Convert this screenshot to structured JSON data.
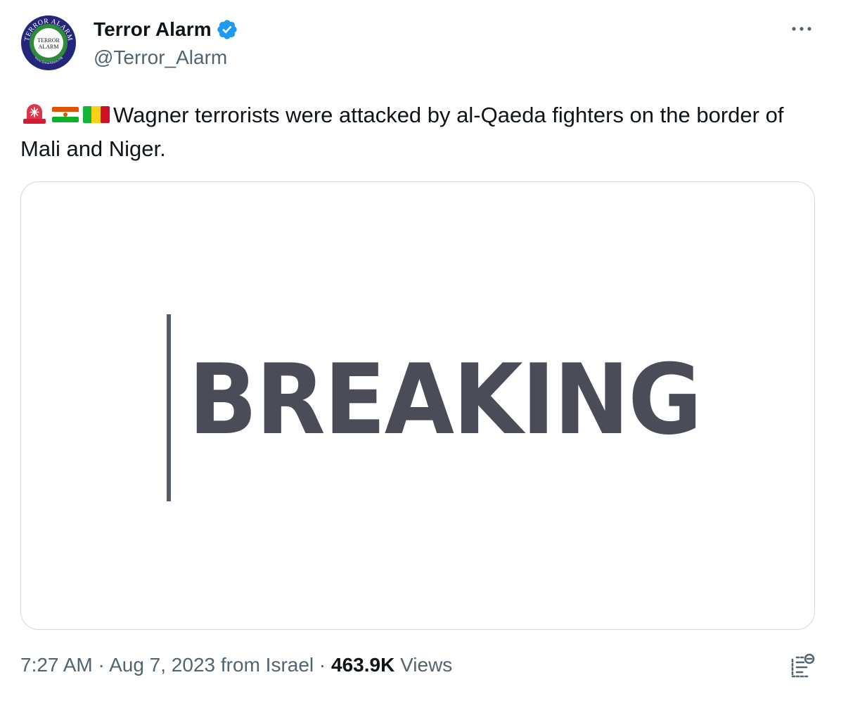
{
  "author": {
    "display_name": "Terror Alarm",
    "handle": "@Terror_Alarm",
    "avatar": {
      "ring_text": "TERROR ALARM",
      "center_line1": "TERROR",
      "center_line2": "ALARM",
      "bottom_text": "www.TerrorAlarm.org",
      "colors": {
        "ring": "#23267a",
        "inner_ring": "#2e8b3a",
        "center": "#ffffff"
      }
    },
    "verified_icon": "verified-badge-icon",
    "verified_color": "#1d9bf0"
  },
  "tweet": {
    "emojis": [
      "rotating-light-emoji",
      "niger-flag-emoji",
      "mali-flag-emoji"
    ],
    "text": "Wagner terrorists were attacked by al-Qaeda fighters on the border of Mali and Niger."
  },
  "media": {
    "headline": "BREAKING",
    "headline_color": "#4a4c58"
  },
  "meta": {
    "time": "7:27 AM",
    "date": "Aug 7, 2023",
    "source": "from Israel",
    "separator": "·",
    "views_count": "463.9K",
    "views_label": "Views"
  },
  "icons": {
    "more": "more-dots-icon",
    "analytics": "analytics-icon"
  }
}
